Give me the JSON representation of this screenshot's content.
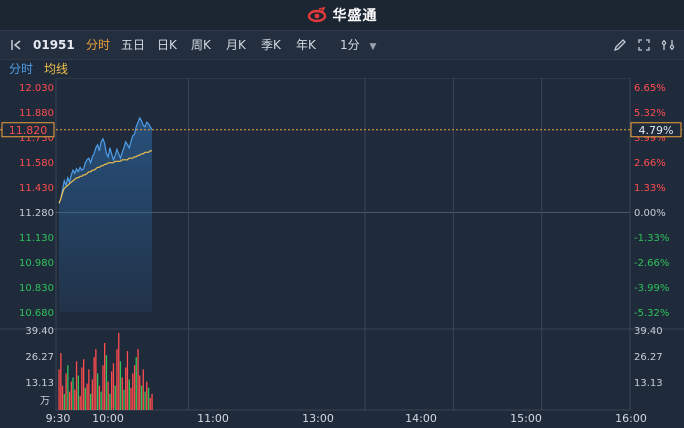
{
  "brand": {
    "name": "华盛通"
  },
  "toolbar": {
    "stock_code": "01951",
    "tabs": [
      "分时",
      "五日",
      "日K",
      "周K",
      "月K",
      "季K",
      "年K"
    ],
    "active_tab": "分时",
    "interval": "1分",
    "icons": [
      "back-icon",
      "pen-icon",
      "expand-icon",
      "settings-icon"
    ]
  },
  "subbar": {
    "timeshare": "分时",
    "average": "均线"
  },
  "colors": {
    "up": "#ff4d4f",
    "down": "#2fc25b",
    "price_line": "#4f9de8",
    "avg_line": "#f0c14b",
    "accent": "#f0a23a"
  },
  "chart_data": {
    "type": "line",
    "current_price": "11.820",
    "current_change": "4.79%",
    "price_axis": [
      "12.030",
      "11.880",
      "11.730",
      "11.580",
      "11.430",
      "11.280",
      "11.130",
      "10.980",
      "10.830",
      "10.680"
    ],
    "pct_axis": [
      "6.65%",
      "5.32%",
      "3.99%",
      "2.66%",
      "1.33%",
      "0.00%",
      "-1.33%",
      "-2.66%",
      "-3.99%",
      "-5.32%"
    ],
    "volume_axis": [
      "39.40",
      "26.27",
      "13.13"
    ],
    "volume_unit": "万",
    "time_axis": [
      "9:30",
      "10:00",
      "11:00",
      "13:00",
      "14:00",
      "15:00",
      "16:00"
    ],
    "price_range": [
      10.605,
      12.105
    ],
    "volume_range": [
      0,
      39.4
    ],
    "series": [
      {
        "values": [
          11.33,
          11.36,
          11.42,
          11.48,
          11.45,
          11.5,
          11.47,
          11.52,
          11.55,
          11.53,
          11.56,
          11.54,
          11.57,
          11.55,
          11.56,
          11.6,
          11.62,
          11.63,
          11.6,
          11.64,
          11.66,
          11.7,
          11.72,
          11.68,
          11.74,
          11.76,
          11.73,
          11.66,
          11.64,
          11.7,
          11.66,
          11.62,
          11.65,
          11.69,
          11.66,
          11.63,
          11.67,
          11.7,
          11.74,
          11.72,
          11.7,
          11.74,
          11.78,
          11.79,
          11.84,
          11.87,
          11.9,
          11.88,
          11.85,
          11.84,
          11.87,
          11.86,
          11.84,
          11.82
        ]
      },
      {
        "values": [
          11.33,
          11.36,
          11.4,
          11.43,
          11.44,
          11.45,
          11.46,
          11.47,
          11.48,
          11.49,
          11.5,
          11.5,
          11.51,
          11.51,
          11.52,
          11.52,
          11.53,
          11.54,
          11.54,
          11.55,
          11.55,
          11.56,
          11.57,
          11.57,
          11.58,
          11.58,
          11.59,
          11.59,
          11.6,
          11.6,
          11.6,
          11.6,
          11.61,
          11.61,
          11.61,
          11.61,
          11.62,
          11.62,
          11.62,
          11.62,
          11.63,
          11.63,
          11.63,
          11.64,
          11.64,
          11.65,
          11.65,
          11.66,
          11.66,
          11.67,
          11.67,
          11.67,
          11.68,
          11.68
        ]
      }
    ],
    "volumes": [
      20,
      28,
      12,
      8,
      18,
      22,
      9,
      14,
      16,
      10,
      24,
      17,
      7,
      21,
      25,
      11,
      13,
      20,
      8,
      15,
      26,
      30,
      18,
      12,
      9,
      22,
      33,
      27,
      14,
      8,
      19,
      23,
      12,
      30,
      38,
      24,
      16,
      10,
      21,
      29,
      15,
      11,
      18,
      22,
      26,
      30,
      17,
      12,
      20,
      9,
      14,
      11,
      6,
      8
    ],
    "volume_dirs": [
      1,
      1,
      1,
      0,
      1,
      0,
      1,
      1,
      0,
      1,
      1,
      0,
      1,
      1,
      1,
      0,
      1,
      1,
      0,
      1,
      1,
      1,
      0,
      1,
      0,
      1,
      1,
      0,
      1,
      0,
      1,
      1,
      0,
      1,
      1,
      0,
      1,
      0,
      1,
      1,
      0,
      1,
      1,
      1,
      0,
      1,
      1,
      0,
      1,
      0,
      1,
      0,
      1,
      1
    ]
  }
}
